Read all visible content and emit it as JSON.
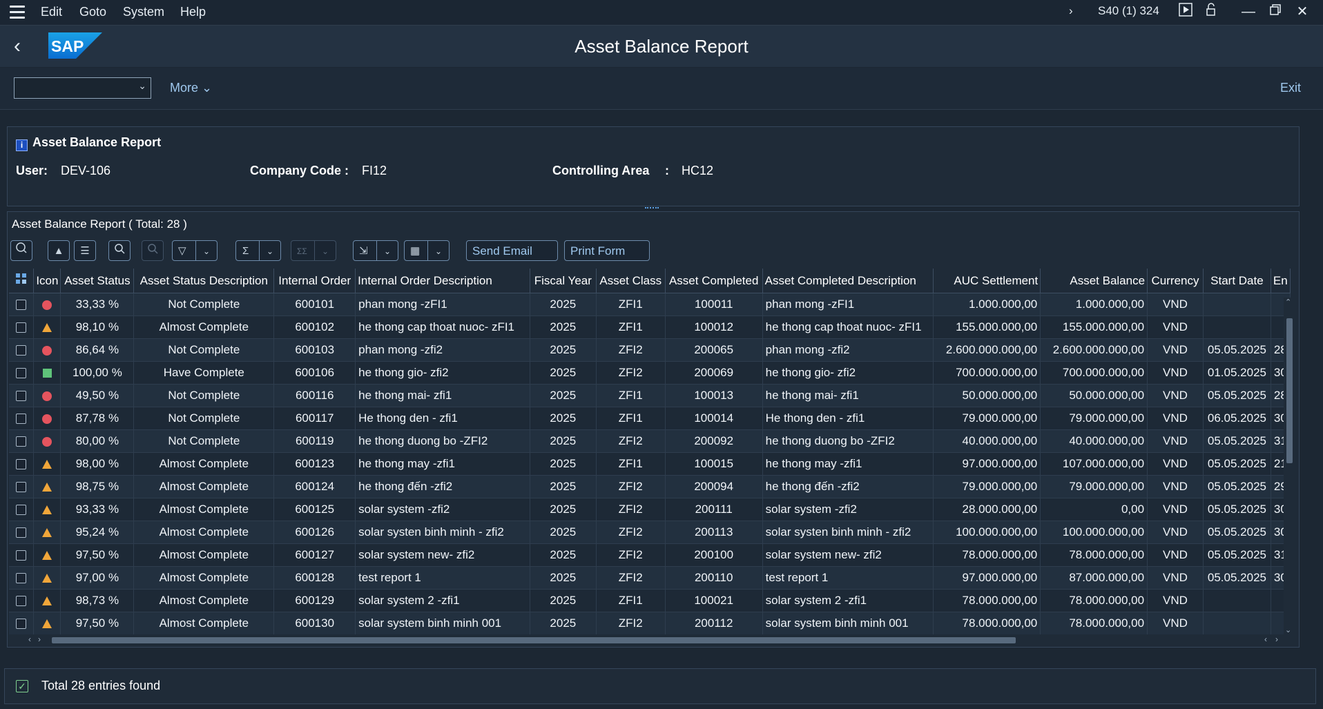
{
  "menu": {
    "edit": "Edit",
    "goto": "Goto",
    "system": "System",
    "help": "Help"
  },
  "system_info": "S40 (1) 324",
  "title": "Asset Balance Report",
  "toolbar": {
    "more": "More",
    "exit": "Exit",
    "select_value": ""
  },
  "info": {
    "title": "Asset Balance Report",
    "user_label": "User:",
    "user_value": "DEV-106",
    "company_label": "Company Code :",
    "company_value": "FI12",
    "area_label": "Controlling Area",
    "area_colon": ":",
    "area_value": "HC12"
  },
  "report": {
    "title": "Asset Balance Report ( Total:  28 )",
    "send_email": "Send Email",
    "print_form": "Print Form",
    "columns": [
      "Icon",
      "Asset Status",
      "Asset Status Description",
      "Internal Order",
      "Internal Order Description",
      "Fiscal Year",
      "Asset Class",
      "Asset Completed",
      "Asset Completed Description",
      "AUC Settlement",
      "Asset Balance",
      "Currency",
      "Start Date",
      "En"
    ],
    "rows": [
      {
        "icon": "red",
        "status": "33,33 %",
        "desc": "Not Complete",
        "order": "600101",
        "order_desc": "phan mong -zFI1",
        "year": "2025",
        "cls": "ZFI1",
        "completed": "100011",
        "comp_desc": "phan mong -zFI1",
        "auc": "1.000.000,00",
        "balance": "1.000.000,00",
        "cur": "VND",
        "start": "",
        "end": ""
      },
      {
        "icon": "yellow",
        "status": "98,10 %",
        "desc": "Almost Complete",
        "order": "600102",
        "order_desc": "he thong cap thoat nuoc- zFI1",
        "year": "2025",
        "cls": "ZFI1",
        "completed": "100012",
        "comp_desc": "he thong cap thoat nuoc- zFI1",
        "auc": "155.000.000,00",
        "balance": "155.000.000,00",
        "cur": "VND",
        "start": "",
        "end": ""
      },
      {
        "icon": "red",
        "status": "86,64 %",
        "desc": "Not Complete",
        "order": "600103",
        "order_desc": "phan mong -zfi2",
        "year": "2025",
        "cls": "ZFI2",
        "completed": "200065",
        "comp_desc": "phan mong -zfi2",
        "auc": "2.600.000.000,00",
        "balance": "2.600.000.000,00",
        "cur": "VND",
        "start": "05.05.2025",
        "end": "28"
      },
      {
        "icon": "green",
        "status": "100,00 %",
        "desc": "Have Complete",
        "order": "600106",
        "order_desc": "he thong gio- zfi2",
        "year": "2025",
        "cls": "ZFI2",
        "completed": "200069",
        "comp_desc": "he thong gio- zfi2",
        "auc": "700.000.000,00",
        "balance": "700.000.000,00",
        "cur": "VND",
        "start": "01.05.2025",
        "end": "30"
      },
      {
        "icon": "red",
        "status": "49,50 %",
        "desc": "Not Complete",
        "order": "600116",
        "order_desc": "he thong mai- zfi1",
        "year": "2025",
        "cls": "ZFI1",
        "completed": "100013",
        "comp_desc": "he thong mai- zfi1",
        "auc": "50.000.000,00",
        "balance": "50.000.000,00",
        "cur": "VND",
        "start": "05.05.2025",
        "end": "28"
      },
      {
        "icon": "red",
        "status": "87,78 %",
        "desc": "Not Complete",
        "order": "600117",
        "order_desc": "He thong den - zfi1",
        "year": "2025",
        "cls": "ZFI1",
        "completed": "100014",
        "comp_desc": "He thong den - zfi1",
        "auc": "79.000.000,00",
        "balance": "79.000.000,00",
        "cur": "VND",
        "start": "06.05.2025",
        "end": "30"
      },
      {
        "icon": "red",
        "status": "80,00 %",
        "desc": "Not Complete",
        "order": "600119",
        "order_desc": "he thong duong bo -ZFI2",
        "year": "2025",
        "cls": "ZFI2",
        "completed": "200092",
        "comp_desc": "he thong duong bo -ZFI2",
        "auc": "40.000.000,00",
        "balance": "40.000.000,00",
        "cur": "VND",
        "start": "05.05.2025",
        "end": "31"
      },
      {
        "icon": "yellow",
        "status": "98,00 %",
        "desc": "Almost Complete",
        "order": "600123",
        "order_desc": "he thong may -zfi1",
        "year": "2025",
        "cls": "ZFI1",
        "completed": "100015",
        "comp_desc": "he thong may -zfi1",
        "auc": "97.000.000,00",
        "balance": "107.000.000,00",
        "cur": "VND",
        "start": "05.05.2025",
        "end": "21"
      },
      {
        "icon": "yellow",
        "status": "98,75 %",
        "desc": "Almost Complete",
        "order": "600124",
        "order_desc": "he thong đến -zfi2",
        "year": "2025",
        "cls": "ZFI2",
        "completed": "200094",
        "comp_desc": "he thong đến -zfi2",
        "auc": "79.000.000,00",
        "balance": "79.000.000,00",
        "cur": "VND",
        "start": "05.05.2025",
        "end": "29"
      },
      {
        "icon": "yellow",
        "status": "93,33 %",
        "desc": "Almost Complete",
        "order": "600125",
        "order_desc": "solar system -zfi2",
        "year": "2025",
        "cls": "ZFI2",
        "completed": "200111",
        "comp_desc": "solar system -zfi2",
        "auc": "28.000.000,00",
        "balance": "0,00",
        "cur": "VND",
        "start": "05.05.2025",
        "end": "30"
      },
      {
        "icon": "yellow",
        "status": "95,24 %",
        "desc": "Almost Complete",
        "order": "600126",
        "order_desc": "solar systen binh minh - zfi2",
        "year": "2025",
        "cls": "ZFI2",
        "completed": "200113",
        "comp_desc": "solar systen binh minh - zfi2",
        "auc": "100.000.000,00",
        "balance": "100.000.000,00",
        "cur": "VND",
        "start": "05.05.2025",
        "end": "30"
      },
      {
        "icon": "yellow",
        "status": "97,50 %",
        "desc": "Almost Complete",
        "order": "600127",
        "order_desc": "solar system new- zfi2",
        "year": "2025",
        "cls": "ZFI2",
        "completed": "200100",
        "comp_desc": "solar system new- zfi2",
        "auc": "78.000.000,00",
        "balance": "78.000.000,00",
        "cur": "VND",
        "start": "05.05.2025",
        "end": "31"
      },
      {
        "icon": "yellow",
        "status": "97,00 %",
        "desc": "Almost Complete",
        "order": "600128",
        "order_desc": "test report 1",
        "year": "2025",
        "cls": "ZFI2",
        "completed": "200110",
        "comp_desc": "test report 1",
        "auc": "97.000.000,00",
        "balance": "87.000.000,00",
        "cur": "VND",
        "start": "05.05.2025",
        "end": "30"
      },
      {
        "icon": "yellow",
        "status": "98,73 %",
        "desc": "Almost Complete",
        "order": "600129",
        "order_desc": "solar system 2 -zfi1",
        "year": "2025",
        "cls": "ZFI1",
        "completed": "100021",
        "comp_desc": "solar system 2 -zfi1",
        "auc": "78.000.000,00",
        "balance": "78.000.000,00",
        "cur": "VND",
        "start": "",
        "end": ""
      },
      {
        "icon": "yellow",
        "status": "97,50 %",
        "desc": "Almost Complete",
        "order": "600130",
        "order_desc": "solar system binh minh 001",
        "year": "2025",
        "cls": "ZFI2",
        "completed": "200112",
        "comp_desc": "solar system binh minh 001",
        "auc": "78.000.000,00",
        "balance": "78.000.000,00",
        "cur": "VND",
        "start": "",
        "end": ""
      }
    ]
  },
  "status": {
    "text": "Total 28 entries found"
  },
  "colors": {
    "red": "#e5545e",
    "yellow": "#f0a63a",
    "green": "#5fc37a",
    "link": "#9fc8ee"
  }
}
